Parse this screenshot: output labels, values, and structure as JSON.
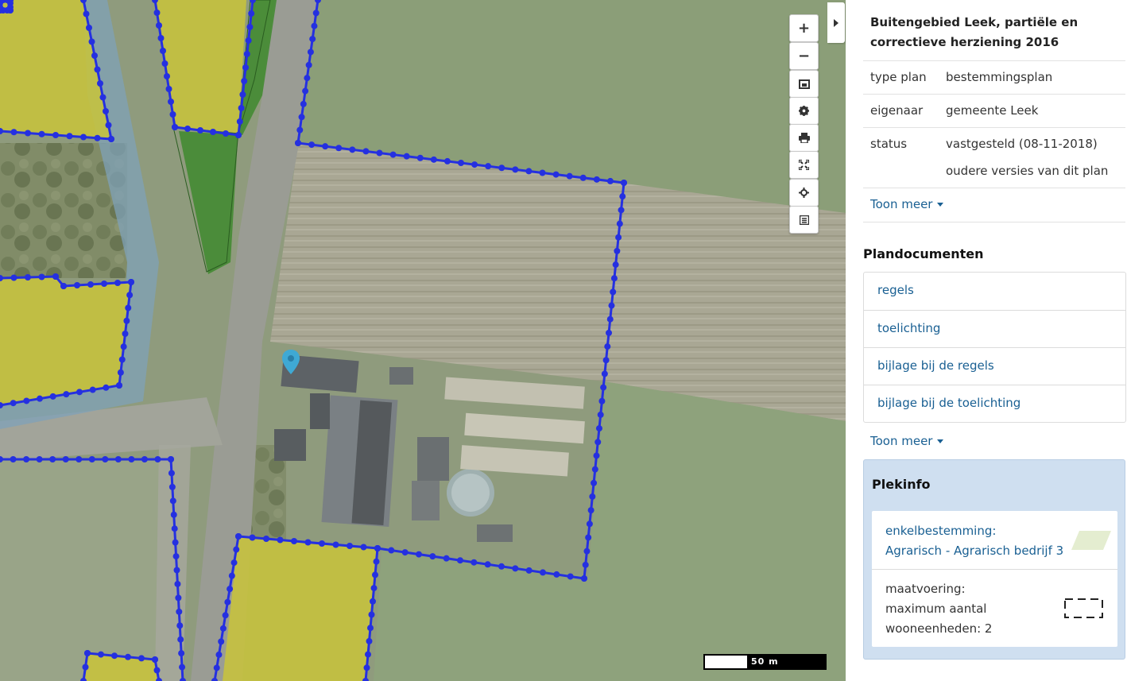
{
  "map": {
    "controls": [
      {
        "name": "zoom-in-button",
        "icon": "plus-icon",
        "glyph": "+"
      },
      {
        "name": "zoom-out-button",
        "icon": "minus-icon",
        "glyph": "−"
      },
      {
        "name": "layers-button",
        "icon": "layers-icon"
      },
      {
        "name": "settings-button",
        "icon": "gear-icon"
      },
      {
        "name": "print-button",
        "icon": "print-icon"
      },
      {
        "name": "fullscreen-button",
        "icon": "fullscreen-icon"
      },
      {
        "name": "locate-button",
        "icon": "crosshair-icon"
      },
      {
        "name": "legend-button",
        "icon": "list-icon"
      }
    ],
    "scale_label": "50 m",
    "colors": {
      "plan_boundary": "#2530e0",
      "residential": "#d7d21c",
      "green": "#3f8a2e",
      "water": "#6e9ec0",
      "marker": "#3fa9d4"
    }
  },
  "panel": {
    "plan_title": "Buitengebied Leek, partiële en correctieve herziening 2016",
    "meta": [
      {
        "key": "type plan",
        "value": "bestemmingsplan"
      },
      {
        "key": "eigenaar",
        "value": "gemeente Leek"
      },
      {
        "key": "status",
        "value": "vastgesteld (08-11-2018)",
        "link": "oudere versies van dit plan"
      }
    ],
    "toon_meer_1": "Toon meer",
    "plandocumenten_heading": "Plandocumenten",
    "documents": [
      "regels",
      "toelichting",
      "bijlage bij de regels",
      "bijlage bij de toelichting"
    ],
    "toon_meer_2": "Toon meer",
    "plekinfo": {
      "heading": "Plekinfo",
      "item1_line1": "enkelbestemming:",
      "item1_line2": "Agrarisch - Agrarisch bedrijf 3",
      "item2_line1": "maatvoering:",
      "item2_line2": "maximum aantal",
      "item2_line3": "wooneenheden: 2"
    }
  }
}
